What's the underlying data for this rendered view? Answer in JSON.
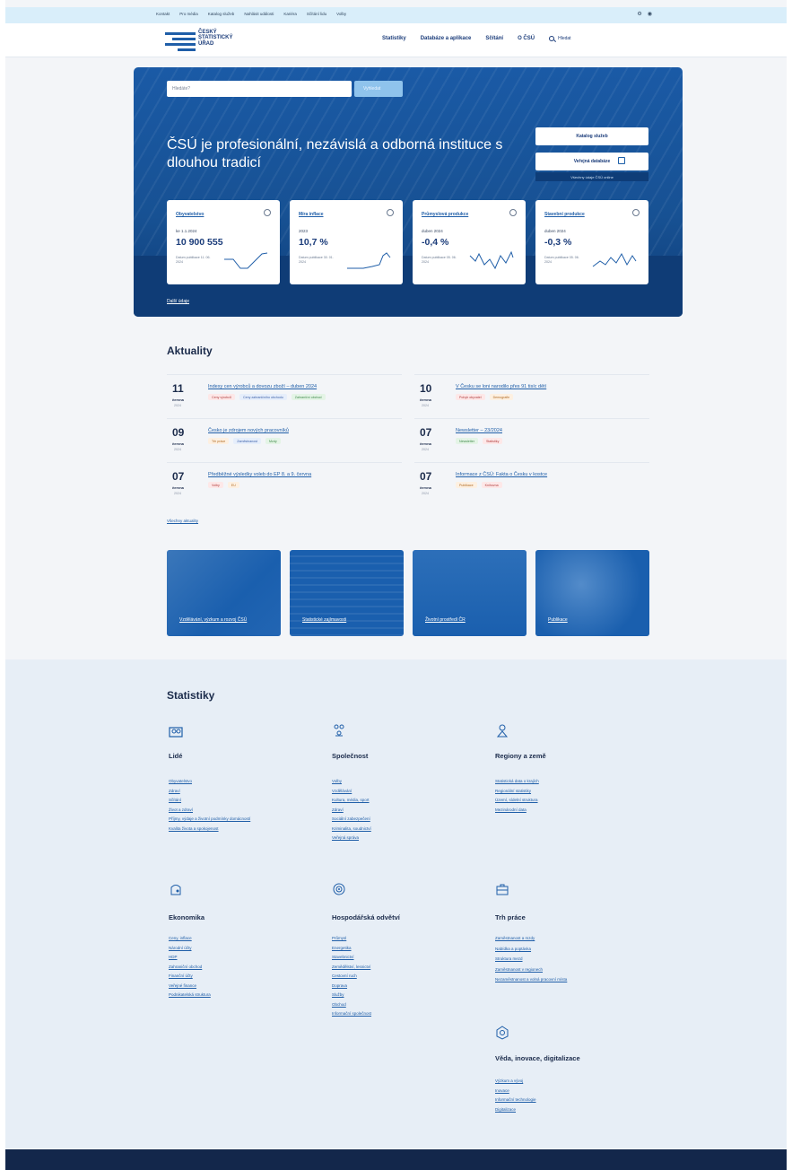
{
  "utility": {
    "links": [
      "Kontakt",
      "Pro média",
      "Katalog služeb",
      "Nahlásit události",
      "Kariéra",
      "Sčítání lidu",
      "Volby"
    ],
    "icons": [
      "settings-icon",
      "accessibility-icon"
    ]
  },
  "header": {
    "logo_text": "ČESKÝ\nSTATISTICKÝ\nÚŘAD",
    "nav": [
      "Statistiky",
      "Databáze a aplikace",
      "Sčítání",
      "O ČSÚ"
    ],
    "search_label": "Hledat"
  },
  "hero": {
    "search_placeholder": "Hledáte?",
    "search_button": "Vyhledat",
    "headline": "ČSÚ je profesionální, nezávislá a odborná instituce s dlouhou tradicí",
    "btn_primary": "Katalog služeb",
    "btn_secondary": "Veřejná databáze",
    "note": "Všechny údaje ČSÚ online",
    "more_link": "Další údaje",
    "cards": [
      {
        "title": "Obyvatelstvo",
        "label": "ke 1.1.2024",
        "value": "10 900 555",
        "note": "Datum publikace 11. 06. 2024"
      },
      {
        "title": "Míra inflace",
        "label": "2023",
        "value": "10,7 %",
        "note": "Datum publikace 30. 01. 2024"
      },
      {
        "title": "Průmyslová produkce",
        "label": "duben 2024",
        "value": "-0,4 %",
        "note": "Datum publikace 05. 06. 2024"
      },
      {
        "title": "Stavební produkce",
        "label": "duben 2024",
        "value": "-0,3 %",
        "note": "Datum publikace 05. 06. 2024"
      }
    ]
  },
  "news": {
    "title": "Aktuality",
    "all_link": "Všechny aktuality",
    "items": [
      {
        "day": "11",
        "month": "června",
        "year": "2024",
        "title": "Indexy cen výrobců a dovozu zboží – duben 2024",
        "tags": [
          [
            "Ceny výrobců",
            "red"
          ],
          [
            "Ceny zahraničního obchodu",
            "blue"
          ],
          [
            "Zahraniční obchod",
            "green"
          ]
        ]
      },
      {
        "day": "10",
        "month": "června",
        "year": "2024",
        "title": "V Česku se loni narodilo přes 91 tisíc dětí",
        "tags": [
          [
            "Pohyb obyvatel",
            "red"
          ],
          [
            "Demografie",
            "orange"
          ]
        ]
      },
      {
        "day": "09",
        "month": "června",
        "year": "2024",
        "title": "Česko je zdrojem nových pracovníků",
        "tags": [
          [
            "Trh práce",
            "orange"
          ],
          [
            "Zaměstnanost",
            "blue"
          ],
          [
            "Mzdy",
            "green"
          ]
        ]
      },
      {
        "day": "07",
        "month": "června",
        "year": "2024",
        "title": "Newsletter – 23/2024",
        "tags": [
          [
            "Newsletter",
            "green"
          ],
          [
            "Statistiky",
            "red"
          ]
        ]
      },
      {
        "day": "07",
        "month": "června",
        "year": "2024",
        "title": "Předběžné výsledky voleb do EP 8. a 9. června",
        "tags": [
          [
            "Volby",
            "red"
          ],
          [
            "EU",
            "orange"
          ]
        ]
      },
      {
        "day": "07",
        "month": "června",
        "year": "2024",
        "title": "Informace z ČSÚ: Fakta o Česku v kostce",
        "tags": [
          [
            "Publikace",
            "orange"
          ],
          [
            "Knihovna",
            "red"
          ]
        ]
      }
    ]
  },
  "tiles": [
    "Vzdělávání, výzkum a rozvoj ČSÚ",
    "Statistické zajímavosti",
    "Životní prostředí ČR",
    "Publikace"
  ],
  "stats": {
    "title": "Statistiky",
    "categories": [
      {
        "title": "Lidé",
        "icon": "people-icon",
        "links": [
          "Obyvatelstvo",
          "Zdraví",
          "Sčítání",
          "Život a zdraví",
          "Příjmy, výdaje a životní podmínky domácností",
          "Kvalita života a spokojenost"
        ]
      },
      {
        "title": "Společnost",
        "icon": "society-icon",
        "links": [
          "Volby",
          "Vzdělávání",
          "Kultura, média, sport",
          "Zdraví",
          "Sociální zabezpečení",
          "Kriminalita, soudnictví",
          "Veřejná správa"
        ]
      },
      {
        "title": "Regiony a země",
        "icon": "region-icon",
        "links": [
          "Statistická data o krajích",
          "Regionální statistiky",
          "Území, sídelní struktura",
          "Mezinárodní data"
        ]
      },
      {
        "title": "Ekonomika",
        "icon": "economy-icon",
        "links": [
          "Ceny, inflace",
          "Národní účty",
          "HDP",
          "Zahraniční obchod",
          "Finanční účty",
          "Veřejné finance",
          "Podnikatelská struktura"
        ]
      },
      {
        "title": "Hospodářská odvětví",
        "icon": "industry-icon",
        "links": [
          "Průmysl",
          "Energetika",
          "Stavebnictví",
          "Zemědělství, lesnictví",
          "Cestovní ruch",
          "Doprava",
          "Služby",
          "Obchod",
          "Informační společnost"
        ]
      },
      {
        "title": "Trh práce",
        "icon": "briefcase-icon",
        "links": [
          "Zaměstnanost a mzdy",
          "Nabídka a poptávka",
          "Struktura mezd",
          "Zaměstnanost v regionech",
          "Nezaměstnanost a volná pracovní místa"
        ]
      },
      {
        "title": "Věda, inovace, digitalizace",
        "icon": "science-icon",
        "links": [
          "Výzkum a vývoj",
          "Inovace",
          "Informační technologie",
          "Digitalizace"
        ]
      }
    ]
  }
}
